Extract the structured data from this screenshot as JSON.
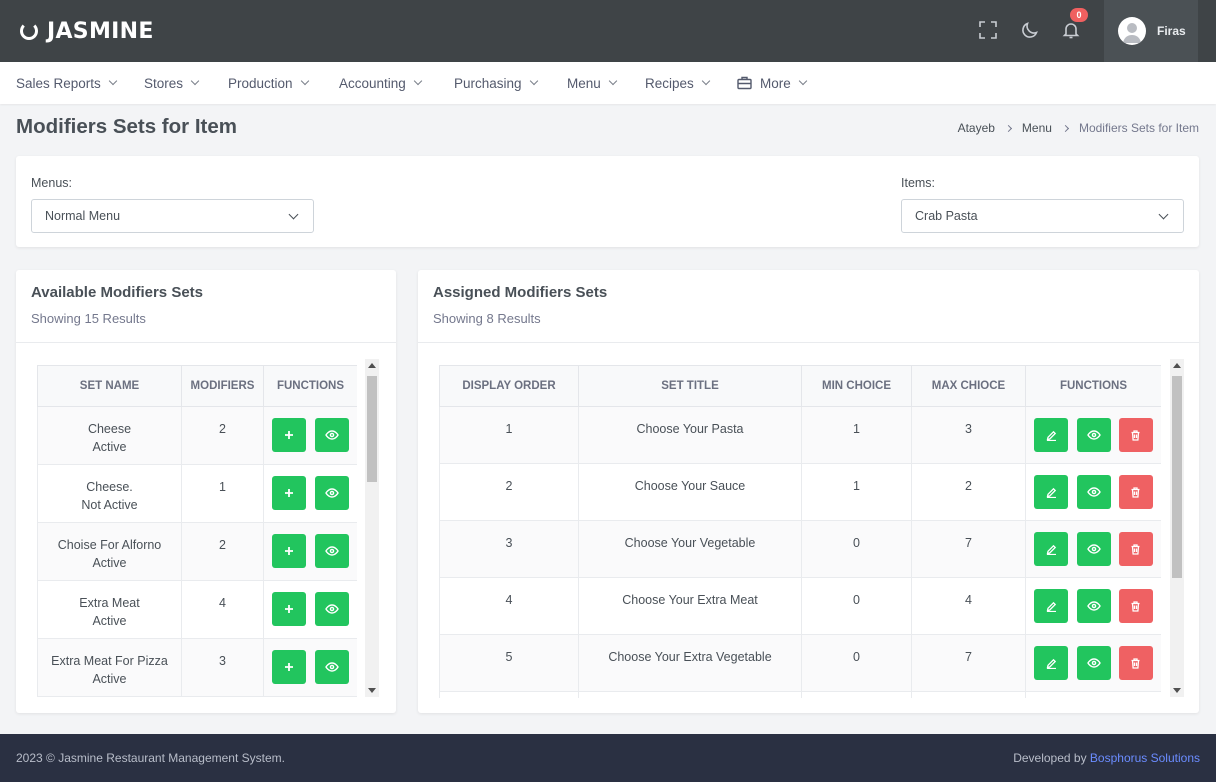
{
  "app": {
    "name": "JASMINE"
  },
  "topbar": {
    "notifications": "0",
    "user": "Firas"
  },
  "nav": [
    "Sales Reports",
    "Stores",
    "Production",
    "Accounting",
    "Purchasing",
    "Menu",
    "Recipes",
    "More"
  ],
  "page": {
    "title": "Modifiers Sets for Item"
  },
  "breadcrumb": [
    "Atayeb",
    "Menu",
    "Modifiers Sets for Item"
  ],
  "filters": {
    "menus_label": "Menus:",
    "menus_value": "Normal Menu",
    "items_label": "Items:",
    "items_value": "Crab Pasta"
  },
  "available": {
    "title": "Available Modifiers Sets",
    "subtitle": "Showing 15 Results",
    "headers": [
      "SET NAME",
      "MODIFIERS",
      "FUNCTIONS"
    ],
    "rows": [
      {
        "name": "Cheese",
        "status": "Active",
        "modifiers": "2"
      },
      {
        "name": "Cheese.",
        "status": "Not Active",
        "modifiers": "1"
      },
      {
        "name": "Choise For Alforno",
        "status": "Active",
        "modifiers": "2"
      },
      {
        "name": "Extra Meat",
        "status": "Active",
        "modifiers": "4"
      },
      {
        "name": "Extra Meat For Pizza",
        "status": "Active",
        "modifiers": "3"
      }
    ]
  },
  "assigned": {
    "title": "Assigned Modifiers Sets",
    "subtitle": "Showing 8 Results",
    "headers": [
      "DISPLAY ORDER",
      "SET TITLE",
      "MIN CHOICE",
      "MAX CHIOCE",
      "FUNCTIONS"
    ],
    "rows": [
      {
        "order": "1",
        "title": "Choose Your Pasta",
        "min": "1",
        "max": "3"
      },
      {
        "order": "2",
        "title": "Choose Your Sauce",
        "min": "1",
        "max": "2"
      },
      {
        "order": "3",
        "title": "Choose Your Vegetable",
        "min": "0",
        "max": "7"
      },
      {
        "order": "4",
        "title": "Choose Your Extra Meat",
        "min": "0",
        "max": "4"
      },
      {
        "order": "5",
        "title": "Choose Your Extra Vegetable",
        "min": "0",
        "max": "7"
      }
    ]
  },
  "footer": {
    "copyright": "2023 © Jasmine Restaurant Management System.",
    "developed_by": "Developed by",
    "company": "Bosphorus Solutions"
  },
  "colors": {
    "topbar": "#3f4447",
    "success": "#22c55e",
    "danger": "#ef6163",
    "footer": "#2a3042",
    "link": "#6b8cff"
  }
}
